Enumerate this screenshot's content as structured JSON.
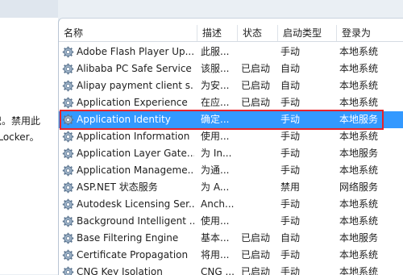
{
  "left_pane": {
    "line1": "识。禁用此",
    "line2": "oLocker。"
  },
  "columns": {
    "name": "名称",
    "desc": "描述",
    "state": "状态",
    "start": "启动类型",
    "logon": "登录为"
  },
  "services": [
    {
      "name": "Adobe Flash Player Up...",
      "desc": "此服...",
      "state": "",
      "start": "手动",
      "logon": "本地系统"
    },
    {
      "name": "Alibaba PC Safe Service",
      "desc": "该服...",
      "state": "已启动",
      "start": "自动",
      "logon": "本地系统"
    },
    {
      "name": "Alipay payment client s...",
      "desc": "为安...",
      "state": "已启动",
      "start": "自动",
      "logon": "本地系统"
    },
    {
      "name": "Application Experience",
      "desc": "在应...",
      "state": "已启动",
      "start": "手动",
      "logon": "本地系统"
    },
    {
      "name": "Application Identity",
      "desc": "确定...",
      "state": "",
      "start": "手动",
      "logon": "本地服务"
    },
    {
      "name": "Application Information",
      "desc": "使用...",
      "state": "",
      "start": "手动",
      "logon": "本地系统"
    },
    {
      "name": "Application Layer Gate...",
      "desc": "为 In...",
      "state": "",
      "start": "手动",
      "logon": "本地服务"
    },
    {
      "name": "Application Manageme...",
      "desc": "为通...",
      "state": "",
      "start": "手动",
      "logon": "本地系统"
    },
    {
      "name": "ASP.NET 状态服务",
      "desc": "为 A...",
      "state": "",
      "start": "禁用",
      "logon": "网络服务"
    },
    {
      "name": "Autodesk Licensing Ser...",
      "desc": "Anch...",
      "state": "",
      "start": "手动",
      "logon": "本地系统"
    },
    {
      "name": "Background Intelligent ...",
      "desc": "使用...",
      "state": "",
      "start": "手动",
      "logon": "本地系统"
    },
    {
      "name": "Base Filtering Engine",
      "desc": "基本...",
      "state": "已启动",
      "start": "自动",
      "logon": "本地服务"
    },
    {
      "name": "Certificate Propagation",
      "desc": "将用...",
      "state": "已启动",
      "start": "手动",
      "logon": "本地系统"
    },
    {
      "name": "CNG Key Isolation",
      "desc": "CNG ...",
      "state": "已启动",
      "start": "手动",
      "logon": "本地系统"
    }
  ],
  "selected_index": 4,
  "colors": {
    "selection": "#3399ff",
    "highlight_border": "#e8232a"
  }
}
